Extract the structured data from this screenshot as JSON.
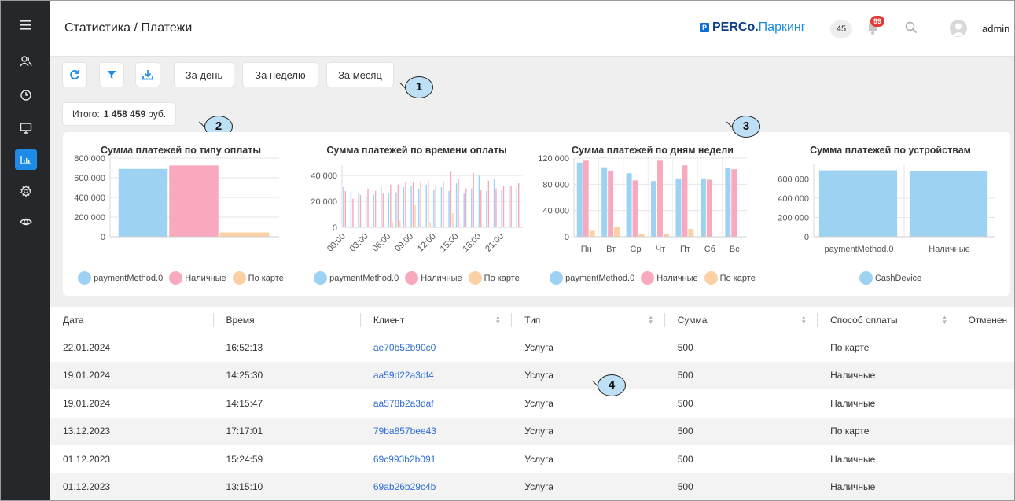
{
  "header": {
    "title": "Статистика / Платежи",
    "brand_main": "PERCo.",
    "brand_sub": "Паркинг",
    "count": "45",
    "notifications": "99",
    "user": "admin"
  },
  "toolbar": {
    "period_day": "За день",
    "period_week": "За неделю",
    "period_month": "За месяц"
  },
  "total": {
    "label": "Итого:",
    "value": "1 458 459",
    "unit": "руб."
  },
  "callouts": [
    "1",
    "2",
    "3",
    "4"
  ],
  "colors": {
    "series1": "#9ed2f3",
    "series2": "#f9a9be",
    "series3": "#fbd0a4",
    "accent": "#1f8be8",
    "link": "#2f6ed8"
  },
  "chart_data": [
    {
      "type": "bar",
      "title": "Сумма платежей по типу оплаты",
      "categories": [
        ""
      ],
      "series": [
        {
          "name": "paymentMethod.0",
          "values": [
            690000
          ]
        },
        {
          "name": "Наличные",
          "values": [
            725000
          ]
        },
        {
          "name": "По карте",
          "values": [
            44000
          ]
        }
      ],
      "yticks": [
        "800 000",
        "600 000",
        "400 000",
        "200 000",
        "0"
      ],
      "ylim": [
        0,
        800000
      ],
      "grid": true,
      "legend": "bottom"
    },
    {
      "type": "bar",
      "title": "Сумма платежей по времени оплаты",
      "categories": [
        "00:00",
        "01:00",
        "02:00",
        "03:00",
        "04:00",
        "05:00",
        "06:00",
        "07:00",
        "08:00",
        "09:00",
        "10:00",
        "11:00",
        "12:00",
        "13:00",
        "14:00",
        "15:00",
        "16:00",
        "17:00",
        "18:00",
        "19:00",
        "20:00",
        "21:00",
        "22:00",
        "23:00"
      ],
      "xticks": [
        "00:00",
        "03:00",
        "06:00",
        "09:00",
        "12:00",
        "15:00",
        "18:00",
        "21:00"
      ],
      "series": [
        {
          "name": "paymentMethod.0",
          "values": [
            31000,
            27000,
            26000,
            24000,
            25000,
            31000,
            26000,
            27000,
            31000,
            32000,
            30000,
            33000,
            29000,
            31000,
            28000,
            34000,
            26000,
            30000,
            40000,
            28000,
            37000,
            29000,
            32000,
            31000
          ]
        },
        {
          "name": "Наличные",
          "values": [
            28000,
            22000,
            25000,
            30000,
            28000,
            26000,
            33000,
            33000,
            35000,
            35000,
            35000,
            36000,
            33000,
            35000,
            43000,
            38000,
            30000,
            42000,
            29000,
            36000,
            30000,
            32000,
            32000,
            34000
          ]
        },
        {
          "name": "По карте",
          "values": [
            0,
            0,
            0,
            0,
            0,
            0,
            4000,
            5000,
            0,
            17000,
            0,
            4000,
            0,
            0,
            11000,
            0,
            0,
            0,
            0,
            0,
            0,
            0,
            0,
            0
          ]
        }
      ],
      "yticks": [
        "40 000",
        "20 000",
        "0"
      ],
      "ylim": [
        0,
        48000
      ],
      "grid": true,
      "legend": "bottom"
    },
    {
      "type": "bar",
      "title": "Сумма платежей по дням недели",
      "categories": [
        "Пн",
        "Вт",
        "Ср",
        "Чт",
        "Пт",
        "Сб",
        "Вс"
      ],
      "series": [
        {
          "name": "paymentMethod.0",
          "values": [
            113000,
            106000,
            97000,
            85000,
            89000,
            89000,
            105000
          ]
        },
        {
          "name": "Наличные",
          "values": [
            116000,
            101000,
            86000,
            116000,
            109000,
            87000,
            103000
          ]
        },
        {
          "name": "По карте",
          "values": [
            9000,
            15000,
            4000,
            4000,
            12000,
            0,
            0
          ]
        }
      ],
      "yticks": [
        "120 000",
        "80 000",
        "40 000",
        "0"
      ],
      "ylim": [
        0,
        120000
      ],
      "grid": true,
      "legend": "bottom"
    },
    {
      "type": "bar",
      "title": "Сумма платежей по устройствам",
      "categories": [
        "paymentMethod.0",
        "Наличные"
      ],
      "series": [
        {
          "name": "CashDevice",
          "values": [
            690000,
            680000
          ]
        }
      ],
      "yticks": [
        "600 000",
        "400 000",
        "200 000",
        "0"
      ],
      "ylim": [
        0,
        760000
      ],
      "grid": true,
      "legend": "bottom"
    }
  ],
  "table": {
    "columns": [
      "Дата",
      "Время",
      "Клиент",
      "Тип",
      "Сумма",
      "Способ оплаты",
      "Отменен"
    ],
    "rows": [
      [
        "22.01.2024",
        "16:52:13",
        "ae70b52b90c0",
        "Услуга",
        "500",
        "По карте"
      ],
      [
        "19.01.2024",
        "14:25:30",
        "aa59d22a3df4",
        "Услуга",
        "500",
        "Наличные"
      ],
      [
        "19.01.2024",
        "14:15:47",
        "aa578b2a3daf",
        "Услуга",
        "500",
        "Наличные"
      ],
      [
        "13.12.2023",
        "17:17:01",
        "79ba857bee43",
        "Услуга",
        "500",
        "По карте"
      ],
      [
        "01.12.2023",
        "15:24:59",
        "69c993b2b091",
        "Услуга",
        "500",
        "Наличные"
      ],
      [
        "01.12.2023",
        "13:15:10",
        "69ab26b29c4b",
        "Услуга",
        "500",
        "Наличные"
      ]
    ]
  }
}
